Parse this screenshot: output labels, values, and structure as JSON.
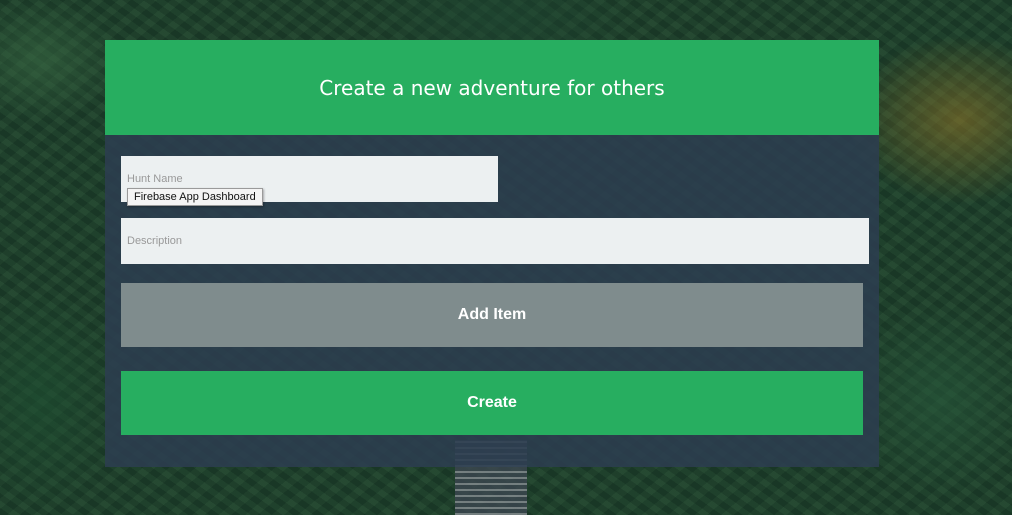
{
  "header": {
    "title": "Create a new adventure for others"
  },
  "form": {
    "hunt_name_placeholder": "Hunt Name",
    "hunt_name_value": "",
    "description_placeholder": "Description",
    "description_value": "",
    "add_item_label": "Add Item",
    "create_label": "Create"
  },
  "tooltip": {
    "text": "Firebase App Dashboard"
  },
  "colors": {
    "accent": "#27ae60",
    "panel": "#2c3e50",
    "secondary_button": "#7f8c8d",
    "input_bg": "#ecf0f1"
  }
}
